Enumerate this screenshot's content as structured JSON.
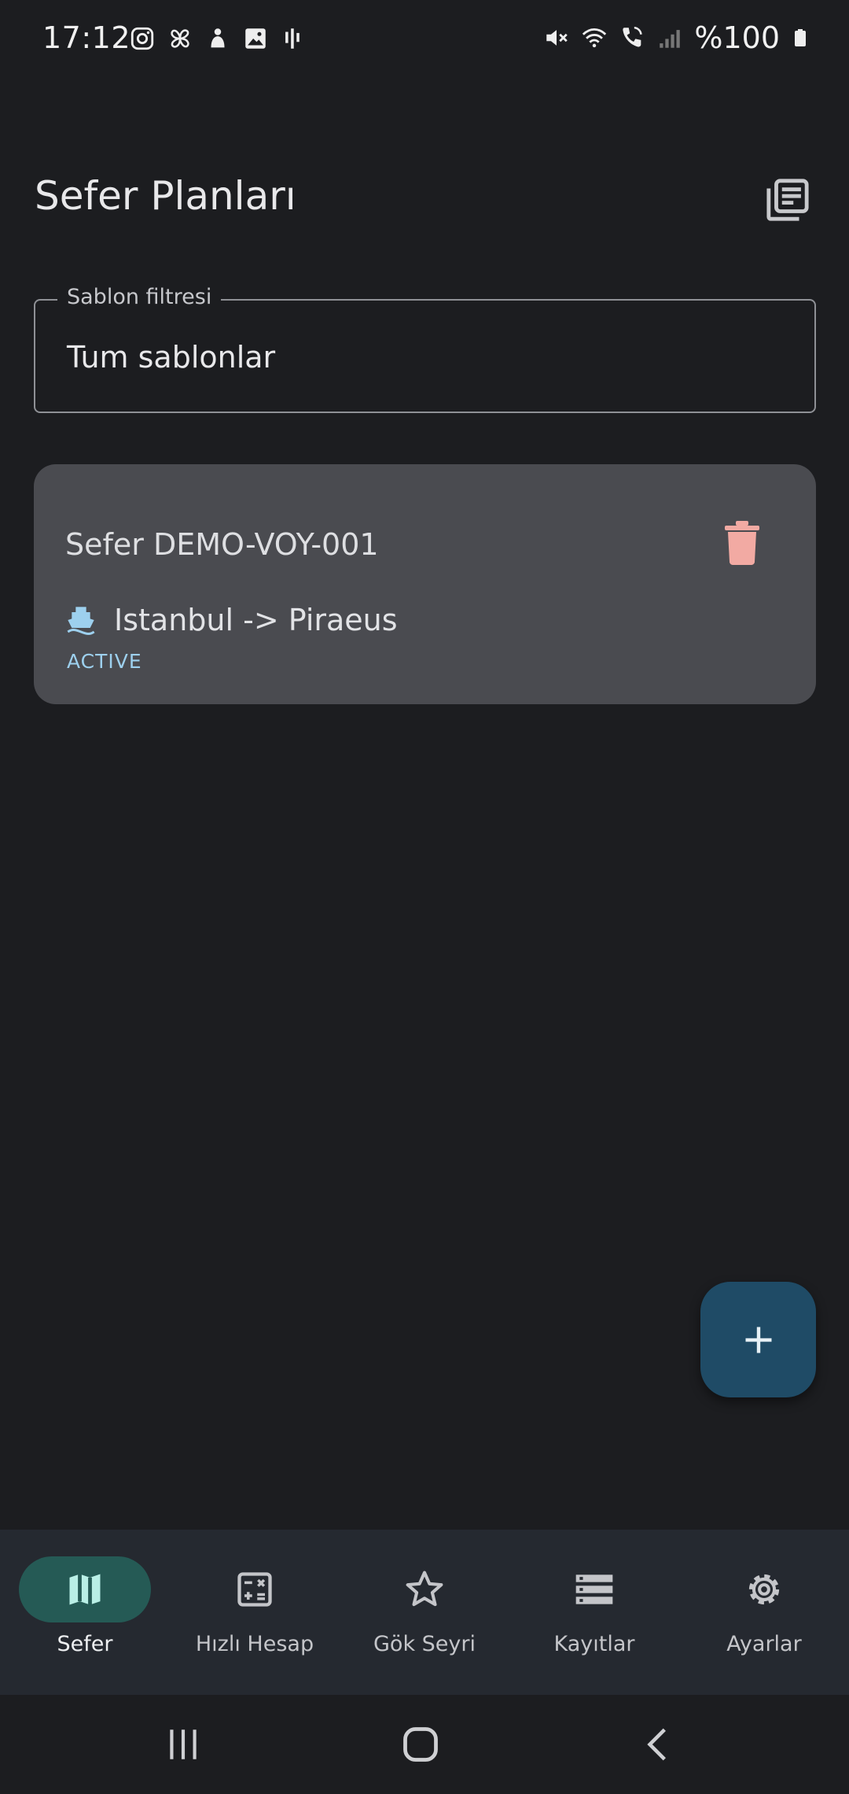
{
  "status_bar": {
    "time": "17:12",
    "battery": "%100",
    "left_icons": [
      "instagram-icon",
      "pinwheel-icon",
      "app-icon",
      "image-icon",
      "voice-icon"
    ],
    "right_icons": [
      "mute-icon",
      "wifi-icon",
      "wifi-calling-icon",
      "signal-icon",
      "battery-icon"
    ]
  },
  "header": {
    "title": "Sefer Planları",
    "action_icon": "library-books-icon"
  },
  "filter": {
    "label": "Sablon filtresi",
    "value": "Tum sablonlar"
  },
  "voyages": [
    {
      "title": "Sefer DEMO-VOY-001",
      "route": "Istanbul -> Piraeus",
      "status": "ACTIVE",
      "route_icon": "ship-icon",
      "delete_icon": "trash-icon"
    }
  ],
  "fab": {
    "icon": "plus-icon"
  },
  "bottom_nav": [
    {
      "label": "Sefer",
      "icon": "map-icon",
      "active": true
    },
    {
      "label": "Hızlı Hesap",
      "icon": "calculator-icon",
      "active": false
    },
    {
      "label": "Gök Seyri",
      "icon": "star-icon",
      "active": false
    },
    {
      "label": "Kayıtlar",
      "icon": "list-icon",
      "active": false
    },
    {
      "label": "Ayarlar",
      "icon": "gear-icon",
      "active": false
    }
  ],
  "system_nav": [
    "recents-icon",
    "home-icon",
    "back-icon"
  ],
  "colors": {
    "background": "#1c1d20",
    "card": "#4a4b50",
    "accent_delete": "#f2aaa3",
    "accent_ship": "#9dd0ee",
    "fab": "#1f4b66",
    "nav_active": "#255a55",
    "nav_active_icon": "#b9efe6"
  }
}
